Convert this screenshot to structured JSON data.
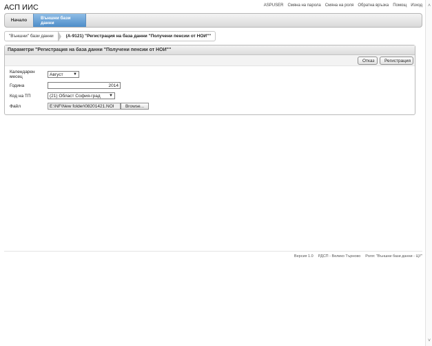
{
  "app": {
    "title": "АСП ИИС"
  },
  "top_links": [
    "ASPUSER",
    "Смяна на парола",
    "Смяна на роля",
    "Обратна връзка",
    "Помощ",
    "Изход"
  ],
  "nav": {
    "home": "Начало",
    "active": "Външни бази данни"
  },
  "breadcrumb": {
    "first": "\"Външни\" бази данни",
    "current": "(А-9121) \"Регистрация на база данни \"Получени пенсии от НОИ\"\""
  },
  "panel": {
    "title": "Параметри \"Регистрация на база данни \"Получени пенсии от НОИ\"\"",
    "cancel": "Отказ",
    "register": "Регистрация"
  },
  "form": {
    "month_label": "Календарен месец",
    "month_value": "Август",
    "year_label": "Година",
    "year_value": "2014",
    "tp_label": "Код на ТП",
    "tp_value": "(21) Област София-град",
    "file_label": "Файл",
    "file_value": "E:\\NF\\New folder\\08201421.NOI",
    "browse": "Browse..."
  },
  "footer": {
    "version": "Версия 1.0",
    "office": "РДСП - Велико Търново",
    "role": "Роля: \"Външни бази данни - ЦУ\""
  },
  "icons": {
    "scroll_up": "chevron-up-icon",
    "scroll_down": "chevron-down-icon",
    "select_arrow": "caret-down-icon"
  }
}
